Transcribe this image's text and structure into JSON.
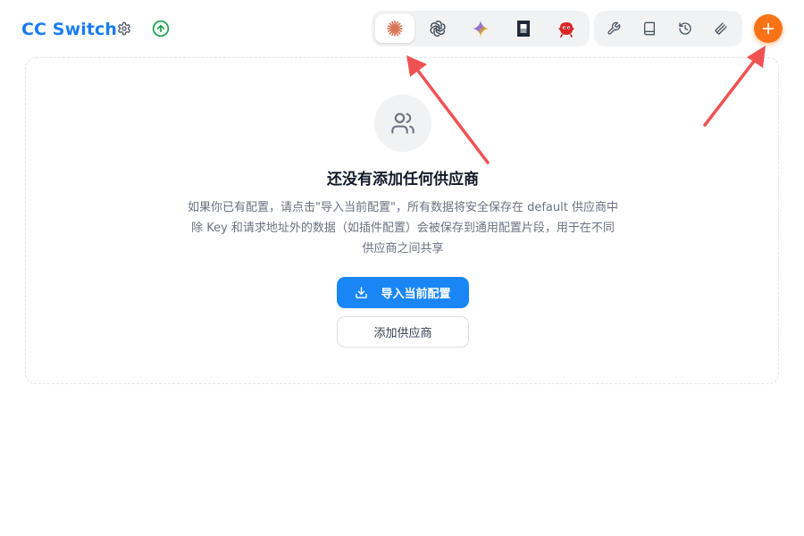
{
  "header": {
    "title": "CC Switch",
    "settings_icon": "gear-icon",
    "update_icon": "arrow-up-circle-icon"
  },
  "app_switcher": {
    "items": [
      {
        "name": "claude",
        "icon": "claude-starburst-icon",
        "active": true
      },
      {
        "name": "codex",
        "icon": "openai-knot-icon",
        "active": false
      },
      {
        "name": "gemini",
        "icon": "gemini-sparkle-icon",
        "active": false
      },
      {
        "name": "opencode",
        "icon": "square-frame-icon",
        "active": false
      },
      {
        "name": "mascot",
        "icon": "red-mascot-icon",
        "active": false
      }
    ]
  },
  "tools": {
    "items": [
      {
        "icon": "wrench-icon"
      },
      {
        "icon": "book-icon"
      },
      {
        "icon": "history-icon"
      },
      {
        "icon": "layers-icon"
      }
    ]
  },
  "add_button": {
    "icon": "plus-icon"
  },
  "empty_state": {
    "icon": "users-icon",
    "title": "还没有添加任何供应商",
    "description_lines": [
      "如果你已有配置，请点击\"导入当前配置\"，所有数据将安全保存在 default 供应商中",
      "除 Key 和请求地址外的数据（如插件配置）会被保存到通用配置片段，用于在不同",
      "供应商之间共享"
    ],
    "import_button": "导入当前配置",
    "add_provider_button": "添加供应商"
  },
  "colors": {
    "brand_blue": "#1a7cf0",
    "primary_button": "#1a86f5",
    "add_button": "#f97316",
    "arrow": "#f05252"
  }
}
